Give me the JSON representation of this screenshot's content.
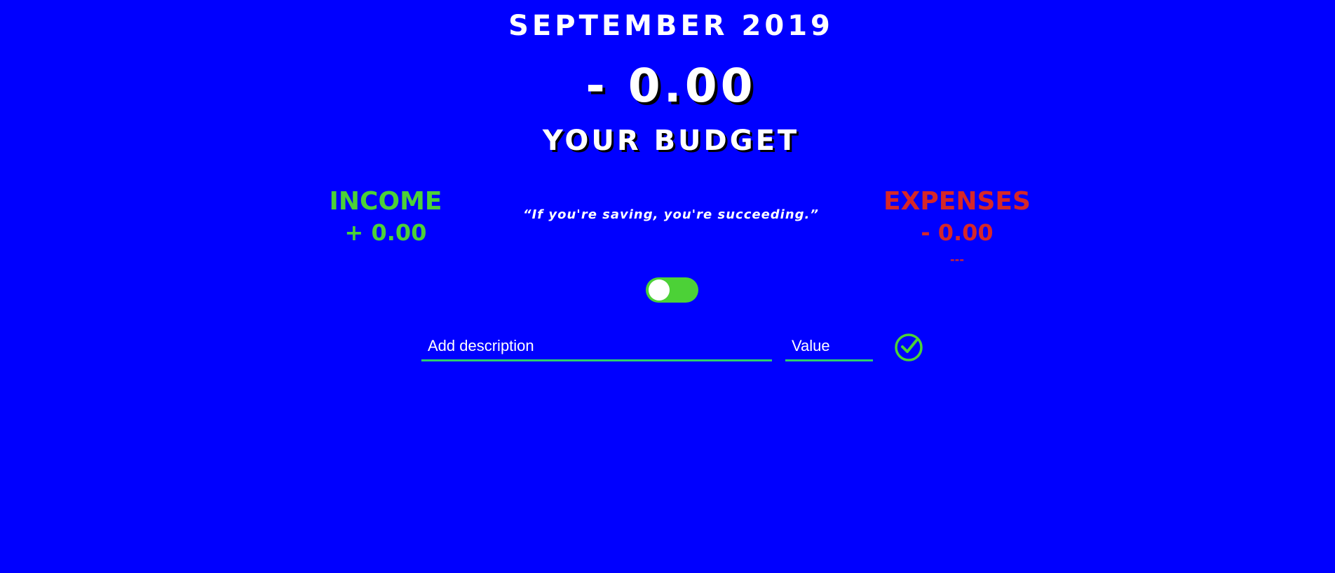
{
  "header": {
    "month": "SEPTEMBER 2019",
    "total": "- 0.00",
    "label": "YOUR BUDGET"
  },
  "income": {
    "title": "INCOME",
    "value": "+ 0.00"
  },
  "quote": "“If you're saving, you're succeeding.”",
  "expenses": {
    "title": "EXPENSES",
    "value": "- 0.00",
    "percentage": "---"
  },
  "toggle": {
    "on": true
  },
  "form": {
    "description_placeholder": "Add description",
    "value_placeholder": "Value"
  },
  "colors": {
    "background": "#0000ff",
    "income": "#4cd137",
    "expenses": "#d62728",
    "input_border": "#2ecc71"
  },
  "icons": {
    "submit": "check-circle-icon"
  }
}
